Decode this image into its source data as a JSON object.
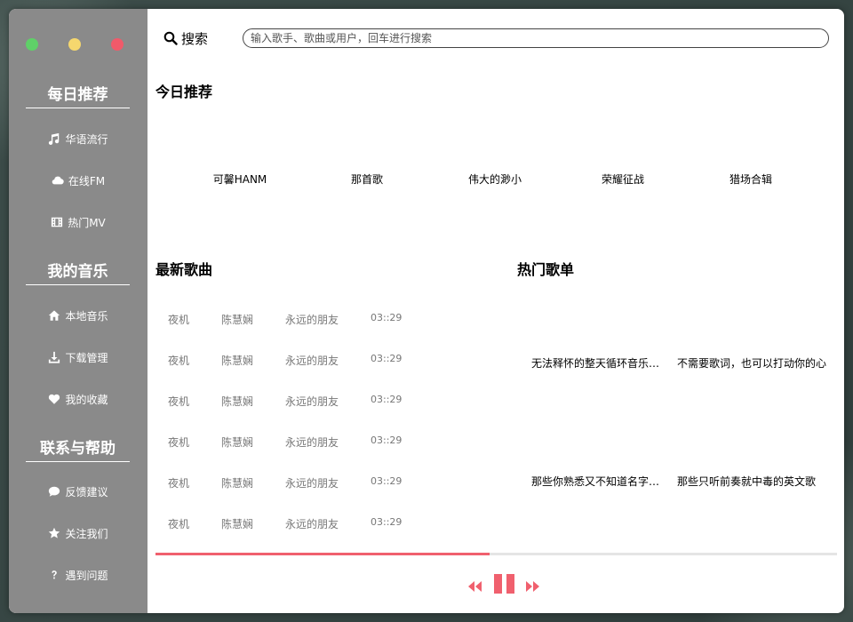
{
  "colors": {
    "accent": "#f0606e",
    "sidebar": "#8a8a8a"
  },
  "sidebar": {
    "sections": [
      {
        "title": "每日推荐",
        "items": [
          {
            "label": "华语流行",
            "icon": "music-note-icon"
          },
          {
            "label": "在线FM",
            "icon": "cloud-icon"
          },
          {
            "label": "热门MV",
            "icon": "film-icon"
          }
        ]
      },
      {
        "title": "我的音乐",
        "items": [
          {
            "label": "本地音乐",
            "icon": "home-icon"
          },
          {
            "label": "下载管理",
            "icon": "download-icon"
          },
          {
            "label": "我的收藏",
            "icon": "heart-icon"
          }
        ]
      },
      {
        "title": "联系与帮助",
        "items": [
          {
            "label": "反馈建议",
            "icon": "comment-icon"
          },
          {
            "label": "关注我们",
            "icon": "star-icon"
          },
          {
            "label": "遇到问题",
            "icon": "question-icon"
          }
        ]
      }
    ]
  },
  "search": {
    "label": "搜索",
    "placeholder": "输入歌手、歌曲或用户，回车进行搜索"
  },
  "today": {
    "title": "今日推荐",
    "items": [
      "可馨HANM",
      "那首歌",
      "伟大的渺小",
      "荣耀征战",
      "猎场合辑"
    ]
  },
  "latest": {
    "title": "最新歌曲",
    "songs": [
      [
        "夜机",
        "陈慧娴",
        "永远的朋友",
        "03::29"
      ],
      [
        "夜机",
        "陈慧娴",
        "永远的朋友",
        "03::29"
      ],
      [
        "夜机",
        "陈慧娴",
        "永远的朋友",
        "03::29"
      ],
      [
        "夜机",
        "陈慧娴",
        "永远的朋友",
        "03::29"
      ],
      [
        "夜机",
        "陈慧娴",
        "永远的朋友",
        "03::29"
      ],
      [
        "夜机",
        "陈慧娴",
        "永远的朋友",
        "03::29"
      ]
    ]
  },
  "hot": {
    "title": "热门歌单",
    "playlists": [
      "无法释怀的整天循环音乐…",
      "不需要歌词，也可以打动你的心",
      "那些你熟悉又不知道名字…",
      "那些只听前奏就中毒的英文歌"
    ]
  },
  "player": {
    "progress": 0.49
  }
}
